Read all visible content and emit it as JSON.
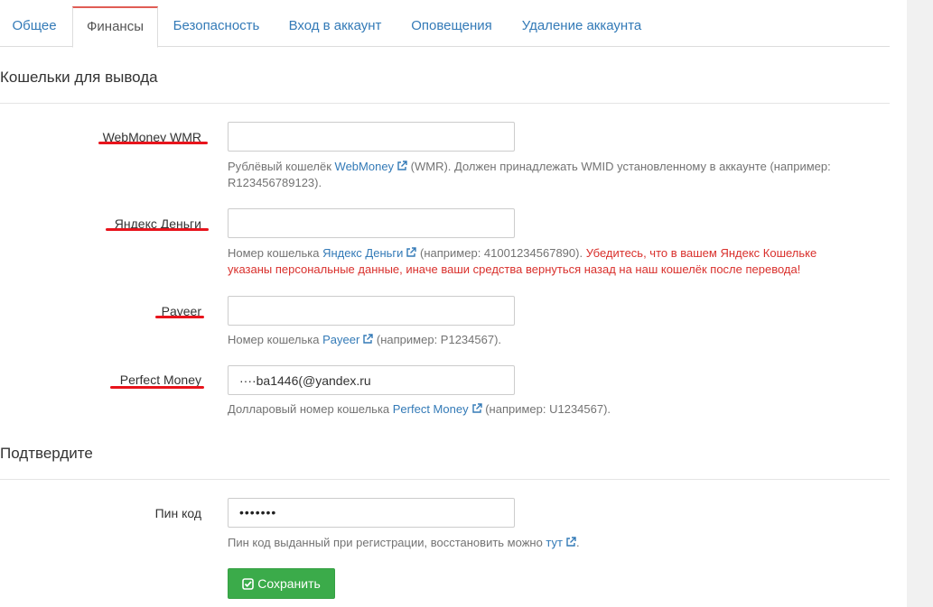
{
  "tabs": [
    {
      "label": "Общее",
      "active": false
    },
    {
      "label": "Финансы",
      "active": true
    },
    {
      "label": "Безопасность",
      "active": false
    },
    {
      "label": "Вход в аккаунт",
      "active": false
    },
    {
      "label": "Оповещения",
      "active": false
    },
    {
      "label": "Удаление аккаунта",
      "active": false
    }
  ],
  "wallets_section": {
    "title": "Кошельки для вывода"
  },
  "fields": {
    "webmoney": {
      "label": "WebMoney WMR",
      "value": "",
      "help_prefix": "Рублёвый кошелёк ",
      "help_link": "WebMoney",
      "help_suffix": " (WMR). Должен принадлежать WMID установленному в аккаунте (например: R123456789123)."
    },
    "yandex": {
      "label": "Яндекс Деньги",
      "value": "",
      "help_prefix": "Номер кошелька ",
      "help_link": "Яндекс Деньги",
      "help_suffix": " (например: 41001234567890). ",
      "help_warning": "Убедитесь, что в вашем Яндекс Кошельке указаны персональные данные, иначе ваши средства вернуться назад на наш кошелёк после перевода!"
    },
    "payeer": {
      "label": "Payeer",
      "value": "",
      "help_prefix": "Номер кошелька ",
      "help_link": "Payeer",
      "help_suffix": " (например: P1234567)."
    },
    "perfect_money": {
      "label": "Perfect Money",
      "value": "····ba1446(@yandex.ru",
      "help_prefix": "Долларовый номер кошелька ",
      "help_link": "Perfect Money",
      "help_suffix": " (например: U1234567)."
    }
  },
  "confirm_section": {
    "title": "Подтвердите"
  },
  "pin": {
    "label": "Пин код",
    "masked_value": "•••••••",
    "help_prefix": "Пин код выданный при регистрации, восстановить можно ",
    "help_link": "тут",
    "help_suffix": "."
  },
  "save_button": {
    "label": "Сохранить"
  },
  "colors": {
    "link": "#337ab7",
    "warning": "#d9302c",
    "save_button": "#3bab4a",
    "active_tab_border": "#e05d55",
    "annotation_underline": "#e8141c"
  },
  "icons": {
    "external_link": "external-link-icon",
    "check": "check-square-icon"
  }
}
